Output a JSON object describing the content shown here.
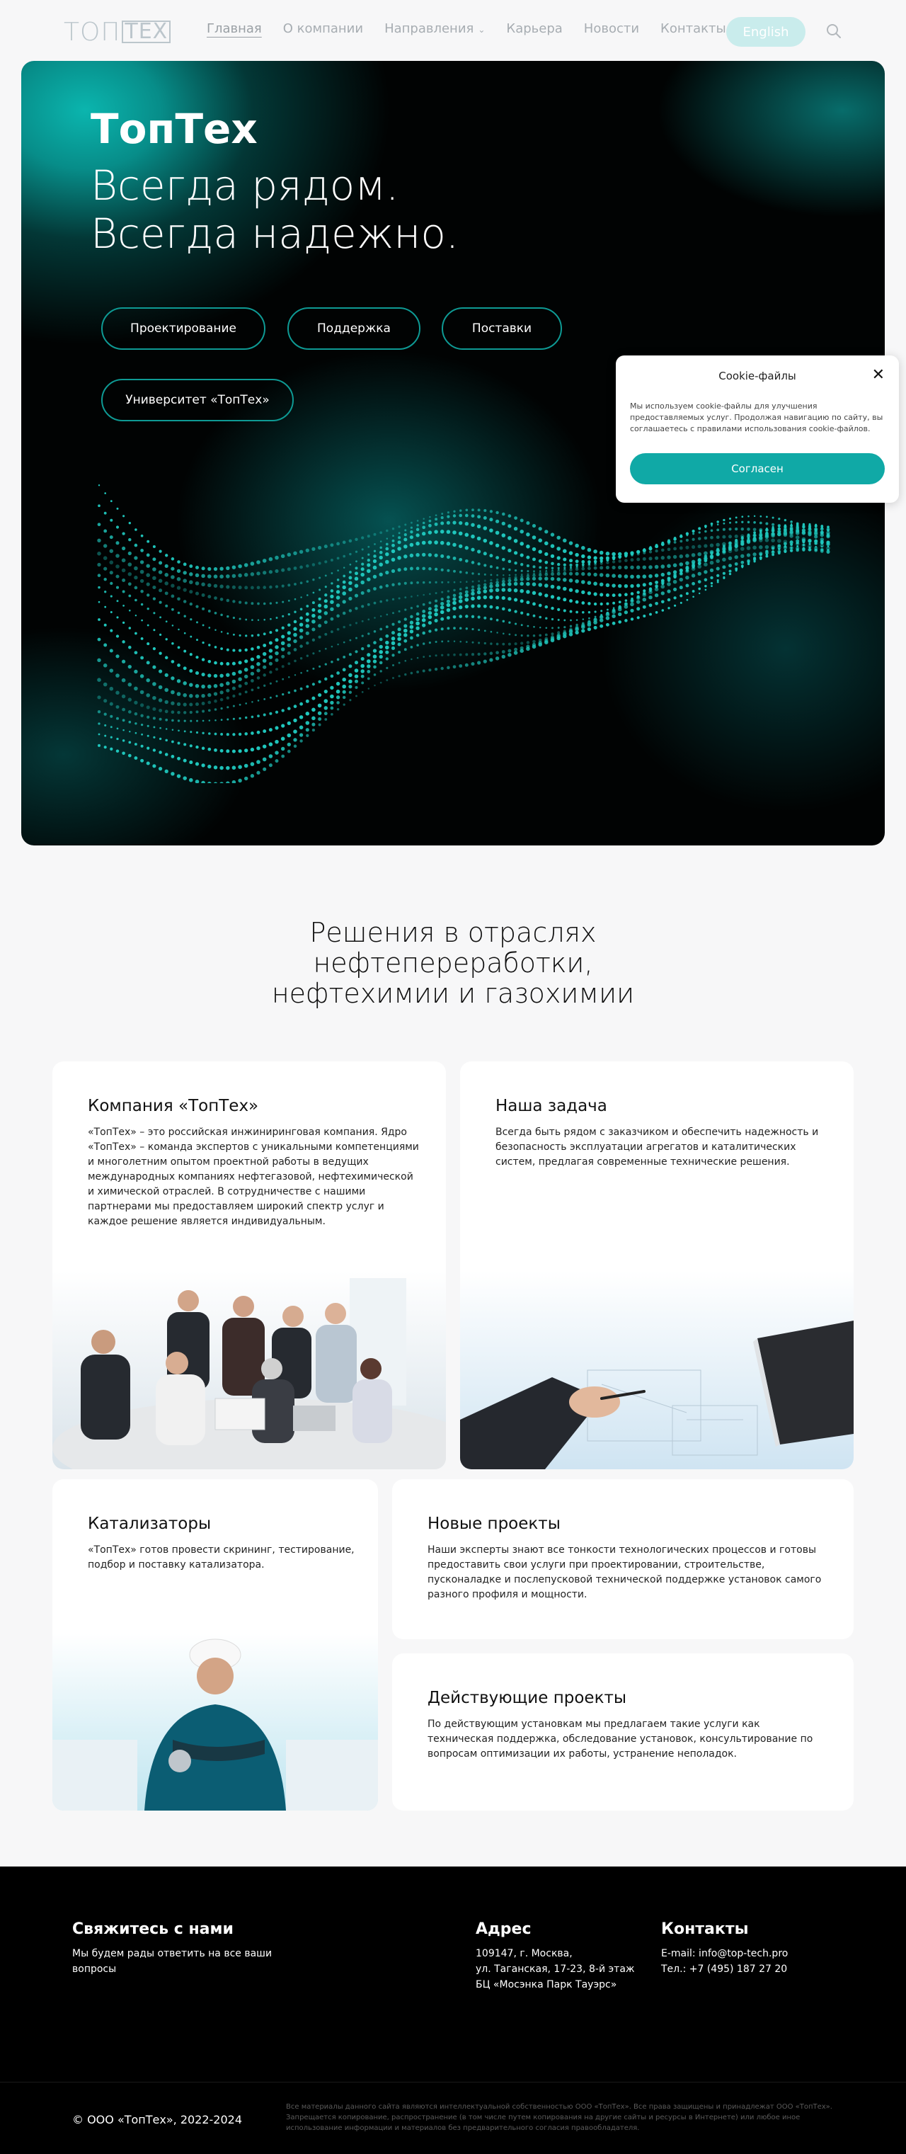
{
  "brand": {
    "logo_part1": "ТОП",
    "logo_part2": "ТЕХ"
  },
  "nav": {
    "items": [
      {
        "label": "Главная"
      },
      {
        "label": "О компании"
      },
      {
        "label": "Направления"
      },
      {
        "label": "Карьера"
      },
      {
        "label": "Новости"
      },
      {
        "label": "Контакты"
      }
    ],
    "lang_button": "English"
  },
  "hero": {
    "brand": "ТопТех",
    "tagline1": "Всегда рядом.",
    "tagline2": "Всегда надежно.",
    "buttons": [
      "Проектирование",
      "Поддержка",
      "Поставки",
      "Университет «ТопТех»"
    ]
  },
  "cookie": {
    "title": "Cookie-файлы",
    "text": "Мы используем cookie-файлы для улучшения предоставляемых услуг. Продолжая навигацию по сайту, вы соглашаетесь с правилами использования cookie-файлов.",
    "accept": "Согласен"
  },
  "solutions": {
    "title_line1": "Решения в отраслях",
    "title_line2": "нефтепереработки,",
    "title_line3": "нефтехимии и газохимии",
    "cards": [
      {
        "title": "Компания «ТопТех»",
        "text": "«ТопТех» – это российская инжиниринговая компания. Ядро «ТопТех» – команда экспертов с уникальными компетенциями и многолетним опытом проектной работы в ведущих международных компаниях нефтегазовой, нефтехимической и химической отраслей. В сотрудничестве с нашими партнерами мы предоставляем широкий спектр услуг и каждое решение является индивидуальным."
      },
      {
        "title": "Наша задача",
        "text": "Всегда быть рядом с заказчиком и обеспечить надежность и безопасность эксплуатации агрегатов и каталитических систем, предлагая современные технические решения."
      },
      {
        "title": "Катализаторы",
        "text": "«ТопТех» готов провести скрининг, тестирование, подбор и поставку катализатора."
      },
      {
        "title": "Новые проекты",
        "text": "Наши эксперты знают все тонкости технологических процессов и готовы предоставить свои услуги при проектировании, строительстве, пусконаладке и послепусковой технической поддержке установок самого разного профиля и мощности."
      },
      {
        "title": "Действующие проекты",
        "text": "По действующим установкам мы предлагаем такие услуги как техническая поддержка, обследование установок, консультирование по вопросам оптимизации их работы, устранение неполадок."
      }
    ]
  },
  "footer": {
    "contact_title": "Свяжитесь с нами",
    "contact_text": "Мы будем рады ответить на все ваши вопросы",
    "address_title": "Адрес",
    "address_line1": "109147, г. Москва,",
    "address_line2": "ул. Таганская, 17-23, 8-й этаж",
    "address_line3": "БЦ «Мосэнка Парк Тауэрс»",
    "contacts_title": "Контакты",
    "email": "E-mail: info@top-tech.pro",
    "phone": "Тел.: +7 (495) 187 27 20",
    "copyright": "© ООО «ТопТех», 2022-2024",
    "legal": "Все материалы данного сайта являются интеллектуальной собственностью ООО «ТопТех». Все права защищены и принадлежат ООО «ТопТех». Запрещается копирование, распространение (в том числе путем копирования на другие сайты и ресурсы в Интернете) или любое иное использование информации и материалов без предварительного согласия правообладателя."
  },
  "colors": {
    "accent": "#10a9a6",
    "hero_bg": "#010303",
    "pill_border": "#0e9a94",
    "footer_bg": "#000000"
  }
}
